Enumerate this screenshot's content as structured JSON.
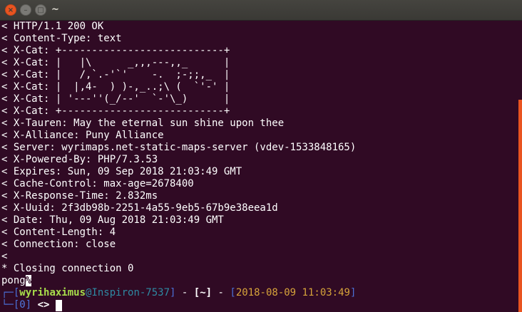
{
  "window": {
    "title": "~",
    "close_glyph": "×",
    "minimize_glyph": "–",
    "maximize_glyph": "□"
  },
  "colors": {
    "background": "#300a24",
    "accent": "#e95420",
    "user": "#a8de4b",
    "host": "#2e8aa3",
    "timestamp": "#d6a33a",
    "bracket": "#4a6fd6"
  },
  "output_lines": [
    "< HTTP/1.1 200 OK",
    "< Content-Type: text",
    "< X-Cat: +---------------------------+",
    "< X-Cat: |   |\\      _,,,---,,_      |",
    "< X-Cat: |   /,`.-'`'    -.  ;-;;,_  |",
    "< X-Cat: |  |,4-  ) )-,_..;\\ (  `'-' |",
    "< X-Cat: | '---''(_/--'  `-'\\_)      |",
    "< X-Cat: +---------------------------+",
    "< X-Tauren: May the eternal sun shine upon thee",
    "< X-Alliance: Puny Alliance",
    "< Server: wyrimaps.net-static-maps-server (vdev-1533848165)",
    "< X-Powered-By: PHP/7.3.53",
    "< Expires: Sun, 09 Sep 2018 21:03:49 GMT",
    "< Cache-Control: max-age=2678400",
    "< X-Response-Time: 2.832ms",
    "< X-Uuid: 2f3db98b-2251-4a55-9eb5-67b9e38eea1d",
    "< Date: Thu, 09 Aug 2018 21:03:49 GMT",
    "< Content-Length: 4",
    "< Connection: close",
    "<",
    "* Closing connection 0"
  ],
  "response_body": "pong",
  "response_end_mark": "%",
  "prompt": {
    "line1_prefix": "┌─[",
    "user": "wyrihaximus",
    "at": "@",
    "host": "Inspiron-7537",
    "close_bracket": "]",
    "dash1": " - ",
    "path_open": "[",
    "path": "~",
    "path_close": "]",
    "dash2": " - ",
    "time_open": "[",
    "timestamp": "2018-08-09 11:03:49",
    "time_close": "]",
    "line2_prefix": "└─[",
    "exit_code": "0",
    "line2_close": "]",
    "symbol": " <> "
  }
}
